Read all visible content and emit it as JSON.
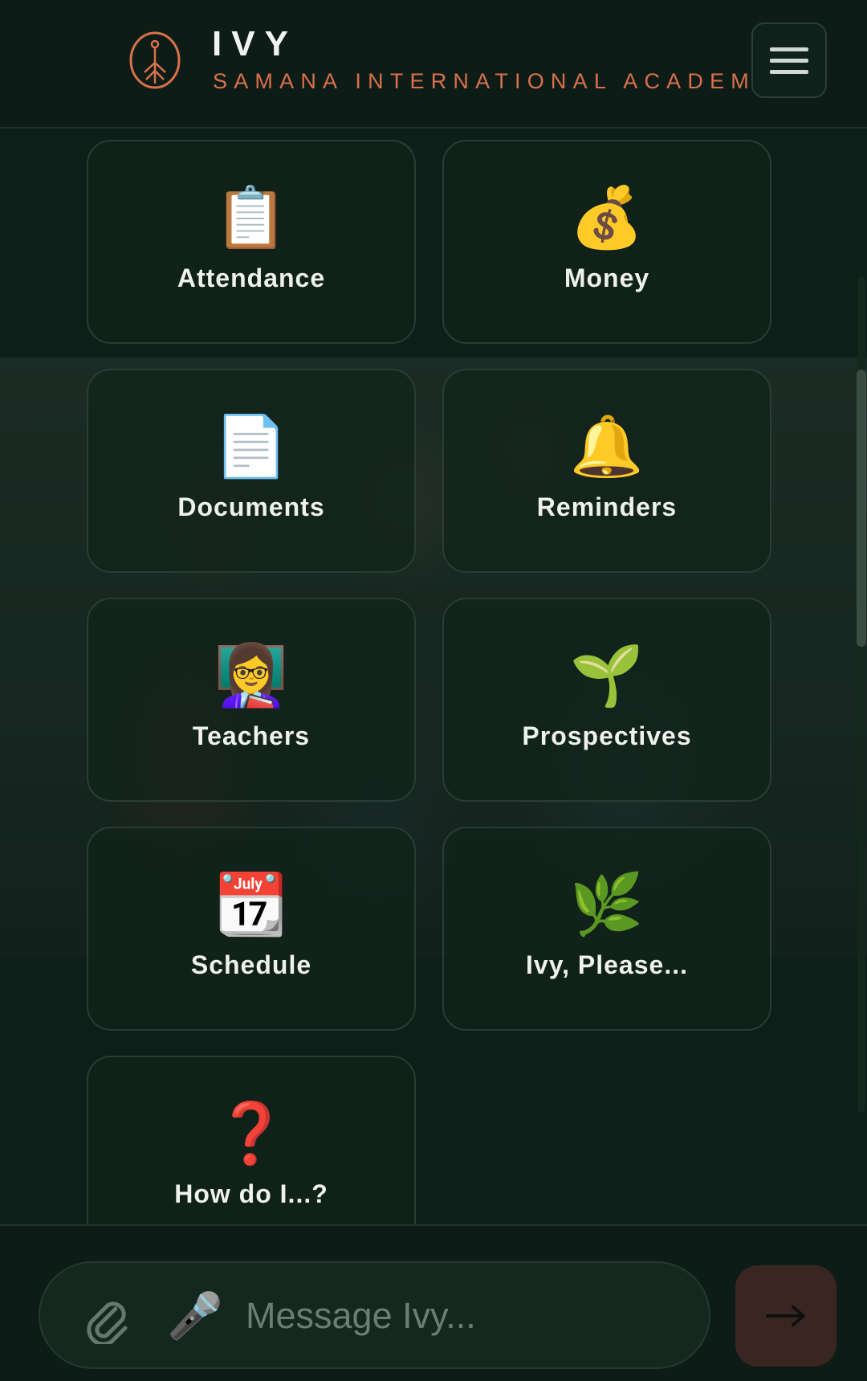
{
  "header": {
    "title": "IVY",
    "subtitle": "SAMANA INTERNATIONAL ACADEMY",
    "logo_icon": "tree-logo-icon",
    "menu_icon": "hamburger-menu-icon",
    "brand_color": "#d9714a"
  },
  "tiles": [
    {
      "label": "Attendance",
      "emoji": "📋",
      "icon": "clipboard-icon"
    },
    {
      "label": "Money",
      "emoji": "💰",
      "icon": "money-bag-icon"
    },
    {
      "label": "Documents",
      "emoji": "📄",
      "icon": "document-icon"
    },
    {
      "label": "Reminders",
      "emoji": "🔔",
      "icon": "bell-icon"
    },
    {
      "label": "Teachers",
      "emoji": "👩‍🏫",
      "icon": "teacher-icon"
    },
    {
      "label": "Prospectives",
      "emoji": "🌱",
      "icon": "seedling-icon"
    },
    {
      "label": "Schedule",
      "emoji": "📆",
      "icon": "calendar-icon"
    },
    {
      "label": "Ivy, Please...",
      "emoji": "🌿",
      "icon": "herb-icon"
    },
    {
      "label": "How do I...?",
      "emoji": "❓",
      "icon": "question-icon"
    }
  ],
  "composer": {
    "placeholder": "Message Ivy...",
    "attach_icon": "paperclip-icon",
    "mic_icon": "microphone-icon",
    "mic_emoji": "🎤",
    "send_icon": "arrow-right-icon"
  }
}
